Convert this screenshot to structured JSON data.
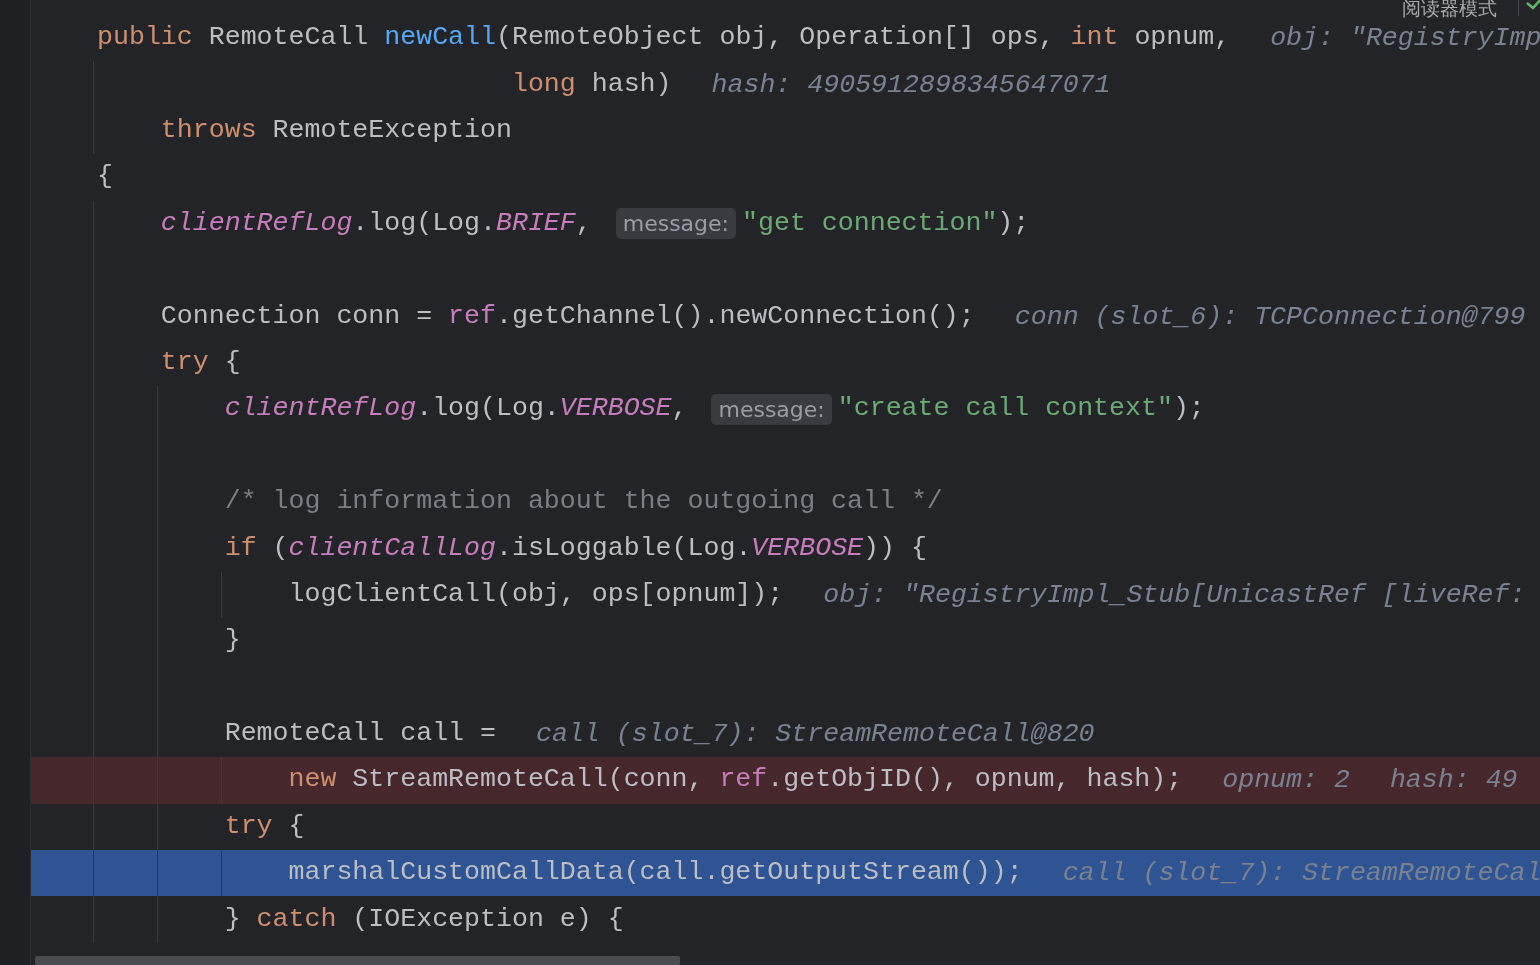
{
  "toolbar": {
    "reader_mode": "阅读器模式"
  },
  "lines": [
    {
      "kind": "code",
      "breakpoint": false,
      "current": false,
      "segments": [
        {
          "kind": "code",
          "tokens": [
            {
              "kind": "kw",
              "text": "public "
            },
            {
              "kind": "plain",
              "text": "RemoteCall "
            },
            {
              "kind": "decl",
              "text": "newCall"
            },
            {
              "kind": "plain",
              "text": "(RemoteObject obj, Operation[] ops, "
            },
            {
              "kind": "kw",
              "text": "int "
            },
            {
              "kind": "plain",
              "text": "opnum,"
            }
          ]
        },
        {
          "kind": "value",
          "text": "obj: \"RegistryImp"
        }
      ]
    },
    {
      "kind": "continuation",
      "breakpoint": false,
      "current": false,
      "segments": [
        {
          "kind": "code",
          "tokens": [
            {
              "kind": "kw",
              "text": "                          long "
            },
            {
              "kind": "plain",
              "text": "hash)"
            }
          ]
        },
        {
          "kind": "value",
          "text": "hash: 4905912898345647071"
        }
      ]
    },
    {
      "kind": "code",
      "breakpoint": false,
      "current": false,
      "segments": [
        {
          "kind": "code",
          "tokens": [
            {
              "kind": "kw",
              "text": "    throws "
            },
            {
              "kind": "plain",
              "text": "RemoteException"
            }
          ]
        }
      ]
    },
    {
      "kind": "code",
      "breakpoint": false,
      "current": false,
      "segments": [
        {
          "kind": "code",
          "tokens": [
            {
              "kind": "plain",
              "text": "{"
            }
          ]
        }
      ]
    },
    {
      "kind": "code",
      "breakpoint": false,
      "current": false,
      "segments": [
        {
          "kind": "code",
          "tokens": [
            {
              "kind": "static",
              "text": "    clientRefLog"
            },
            {
              "kind": "plain",
              "text": ".log(Log."
            },
            {
              "kind": "static",
              "text": "BRIEF"
            },
            {
              "kind": "plain",
              "text": ", "
            }
          ]
        },
        {
          "kind": "hint",
          "text": "message:"
        },
        {
          "kind": "code",
          "tokens": [
            {
              "kind": "str",
              "text": "\"get connection\""
            },
            {
              "kind": "plain",
              "text": ");"
            }
          ]
        }
      ]
    },
    {
      "kind": "blank",
      "breakpoint": false,
      "current": false
    },
    {
      "kind": "code",
      "breakpoint": false,
      "current": false,
      "segments": [
        {
          "kind": "code",
          "tokens": [
            {
              "kind": "plain",
              "text": "    Connection conn = "
            },
            {
              "kind": "field",
              "text": "ref"
            },
            {
              "kind": "plain",
              "text": ".getChannel().newConnection();"
            }
          ]
        },
        {
          "kind": "value",
          "text": "conn (slot_6): TCPConnection@799"
        }
      ]
    },
    {
      "kind": "code",
      "breakpoint": false,
      "current": false,
      "segments": [
        {
          "kind": "code",
          "tokens": [
            {
              "kind": "kw",
              "text": "    try "
            },
            {
              "kind": "plain",
              "text": "{"
            }
          ]
        }
      ]
    },
    {
      "kind": "code",
      "breakpoint": false,
      "current": false,
      "segments": [
        {
          "kind": "code",
          "tokens": [
            {
              "kind": "static",
              "text": "        clientRefLog"
            },
            {
              "kind": "plain",
              "text": ".log(Log."
            },
            {
              "kind": "static",
              "text": "VERBOSE"
            },
            {
              "kind": "plain",
              "text": ", "
            }
          ]
        },
        {
          "kind": "hint",
          "text": "message:"
        },
        {
          "kind": "code",
          "tokens": [
            {
              "kind": "str",
              "text": "\"create call context\""
            },
            {
              "kind": "plain",
              "text": ");"
            }
          ]
        }
      ]
    },
    {
      "kind": "blank",
      "breakpoint": false,
      "current": false
    },
    {
      "kind": "code",
      "breakpoint": false,
      "current": false,
      "segments": [
        {
          "kind": "code",
          "tokens": [
            {
              "kind": "comment",
              "text": "        /* log information about the outgoing call */"
            }
          ]
        }
      ]
    },
    {
      "kind": "code",
      "breakpoint": false,
      "current": false,
      "segments": [
        {
          "kind": "code",
          "tokens": [
            {
              "kind": "kw",
              "text": "        if "
            },
            {
              "kind": "plain",
              "text": "("
            },
            {
              "kind": "static",
              "text": "clientCallLog"
            },
            {
              "kind": "plain",
              "text": ".isLoggable(Log."
            },
            {
              "kind": "static",
              "text": "VERBOSE"
            },
            {
              "kind": "plain",
              "text": ")) {"
            }
          ]
        }
      ]
    },
    {
      "kind": "code",
      "breakpoint": false,
      "current": false,
      "segments": [
        {
          "kind": "code",
          "tokens": [
            {
              "kind": "plain",
              "text": "            logClientCall(obj, ops[opnum]);"
            }
          ]
        },
        {
          "kind": "value",
          "text": "obj: \"RegistryImpl_Stub[UnicastRef [liveRef:"
        }
      ]
    },
    {
      "kind": "code",
      "breakpoint": false,
      "current": false,
      "segments": [
        {
          "kind": "code",
          "tokens": [
            {
              "kind": "plain",
              "text": "        }"
            }
          ]
        }
      ]
    },
    {
      "kind": "blank",
      "breakpoint": false,
      "current": false
    },
    {
      "kind": "code",
      "breakpoint": false,
      "current": false,
      "segments": [
        {
          "kind": "code",
          "tokens": [
            {
              "kind": "plain",
              "text": "        RemoteCall call ="
            }
          ]
        },
        {
          "kind": "value",
          "text": "call (slot_7): StreamRemoteCall@820"
        }
      ]
    },
    {
      "kind": "continuation",
      "breakpoint": true,
      "current": false,
      "segments": [
        {
          "kind": "code",
          "tokens": [
            {
              "kind": "kw",
              "text": "            new "
            },
            {
              "kind": "plain",
              "text": "StreamRemoteCall(conn, "
            },
            {
              "kind": "field",
              "text": "ref"
            },
            {
              "kind": "plain",
              "text": ".getObjID(), opnum, hash);"
            }
          ]
        },
        {
          "kind": "value",
          "text": "opnum: 2"
        },
        {
          "kind": "value",
          "text": "hash: 49"
        }
      ]
    },
    {
      "kind": "code",
      "breakpoint": false,
      "current": false,
      "segments": [
        {
          "kind": "code",
          "tokens": [
            {
              "kind": "kw",
              "text": "        try "
            },
            {
              "kind": "plain",
              "text": "{"
            }
          ]
        }
      ]
    },
    {
      "kind": "code",
      "breakpoint": false,
      "current": true,
      "segments": [
        {
          "kind": "code",
          "tokens": [
            {
              "kind": "plain",
              "text": "            marshalCustomCallData(call.getOutputStream());"
            }
          ]
        },
        {
          "kind": "value",
          "text": "call (slot_7): StreamRemoteCal"
        }
      ]
    },
    {
      "kind": "code",
      "breakpoint": false,
      "current": false,
      "segments": [
        {
          "kind": "code",
          "tokens": [
            {
              "kind": "plain",
              "text": "        } "
            },
            {
              "kind": "kw",
              "text": "catch "
            },
            {
              "kind": "plain",
              "text": "(IOException e) {"
            }
          ]
        }
      ]
    }
  ]
}
